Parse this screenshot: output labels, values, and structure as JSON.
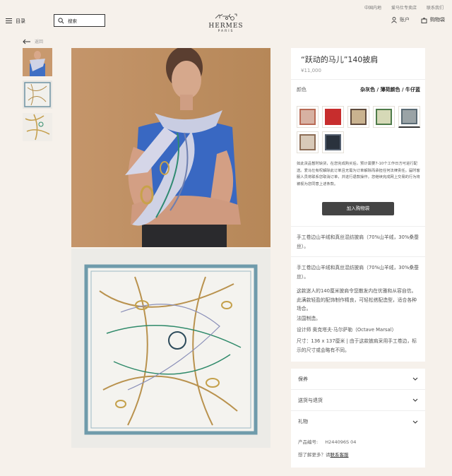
{
  "top_links": [
    "中国内地",
    "爱马仕专卖店",
    "联系我们"
  ],
  "header": {
    "menu_label": "目录",
    "search_placeholder": "搜索",
    "brand": "HERMES",
    "brand_city": "PARIS",
    "account_label": "账户",
    "cart_label": "购物袋"
  },
  "nav": {
    "back_label": "返回"
  },
  "product": {
    "title": "“跃动的马儿”140披肩",
    "price": "¥11,000",
    "color_label": "颜色",
    "color_value": "杂灰色 / 薄荷颜色 / 牛仔蓝",
    "swatches": [
      {
        "name": "swatch-1",
        "color": "#d7b1a2"
      },
      {
        "name": "swatch-2",
        "color": "#c72d2d"
      },
      {
        "name": "swatch-3",
        "color": "#c9b28f"
      },
      {
        "name": "swatch-4",
        "color": "#d6d9b7"
      },
      {
        "name": "swatch-5",
        "color": "#9aa3a6"
      },
      {
        "name": "swatch-6",
        "color": "#d8c9b8"
      },
      {
        "name": "swatch-7",
        "color": "#2a323d"
      }
    ],
    "notice": "如此货品暂时缺货，在您完成购买后，预计需要7-10个工作日方可进行配送。爱马仕有权解除此订单且无需为订单解除而承担任何法律责任。届时客服人员将联系您取消订单，并进行退款操作。您继续完成网上交易的行为将被视为您同意上述条款。",
    "add_to_bag": "加入购物袋",
    "material_short": "手工卷边山羊绒和真丝混纺披肩（70%山羊绒，30%桑蚕丝）。",
    "material": "手工卷边山羊绒和真丝混纺披肩（70%山羊绒，30%桑蚕丝）。",
    "description": "这款迷人的140厘米披肩令您散发内在优雅和从容自信。此满款轻盈的配饰制作精良，可轻松搭配造型，适合各种场合。",
    "made_in": "法国制造。",
    "designer": "设计师 奥克塔夫·马尔萨勒（Octave Marsal）",
    "size": "尺寸：136 x 137厘米 | 由于这款披肩采用手工卷边，标示的尺寸或会略有不同。",
    "accordions": [
      "保养",
      "送货与退货",
      "礼物"
    ],
    "sku_label": "产品编号:",
    "sku": "H244096S 04",
    "more_prefix": "想了解更多？请",
    "more_link": "联系客服"
  }
}
